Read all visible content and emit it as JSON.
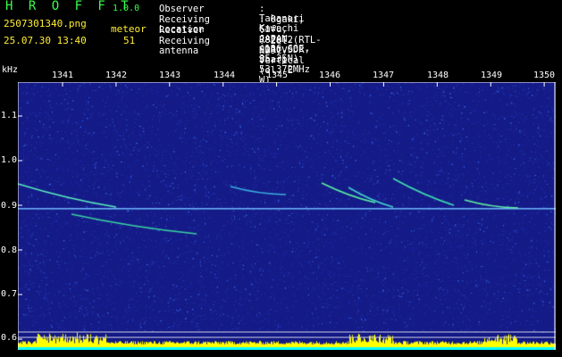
{
  "header": {
    "app_title": "H R O F F T",
    "app_version": "1.0.0",
    "file_name": "2507301340.png",
    "date_time": "25.07.30 13:40",
    "meteor_label": "meteor",
    "meteor_count": "51"
  },
  "station_info": [
    {
      "label": "Observer",
      "value": ": Takanori Kawachi"
    },
    {
      "label": "Receiving Location",
      "value": ": Ogaki, Gifu, JAPAN (136.60E, 35.35N)"
    },
    {
      "label": "Receiver",
      "value": ": R820T2(RTL-SDR) SDR-Sharp 53.372MHz"
    },
    {
      "label": "Receiving antenna",
      "value": ": 2el-HB9CV Vertical (el. E-W)"
    }
  ],
  "axis": {
    "unit": "kHz",
    "x_ticks": [
      "1341",
      "1342",
      "1343",
      "1344",
      "1345",
      "1346",
      "1347",
      "1348",
      "1349",
      "1350"
    ],
    "y_ticks": [
      "1.1",
      "1.0",
      "0.9",
      "0.8",
      "0.7",
      "0.6"
    ]
  },
  "colors": {
    "background": "#000000",
    "plot_bg": "#141a86",
    "title_green": "#39ff4a",
    "text_yellow": "#ffee33",
    "text_white": "#ffffff",
    "activity_yellow": "#ffff00",
    "activity_cyan": "#00ffff"
  }
}
